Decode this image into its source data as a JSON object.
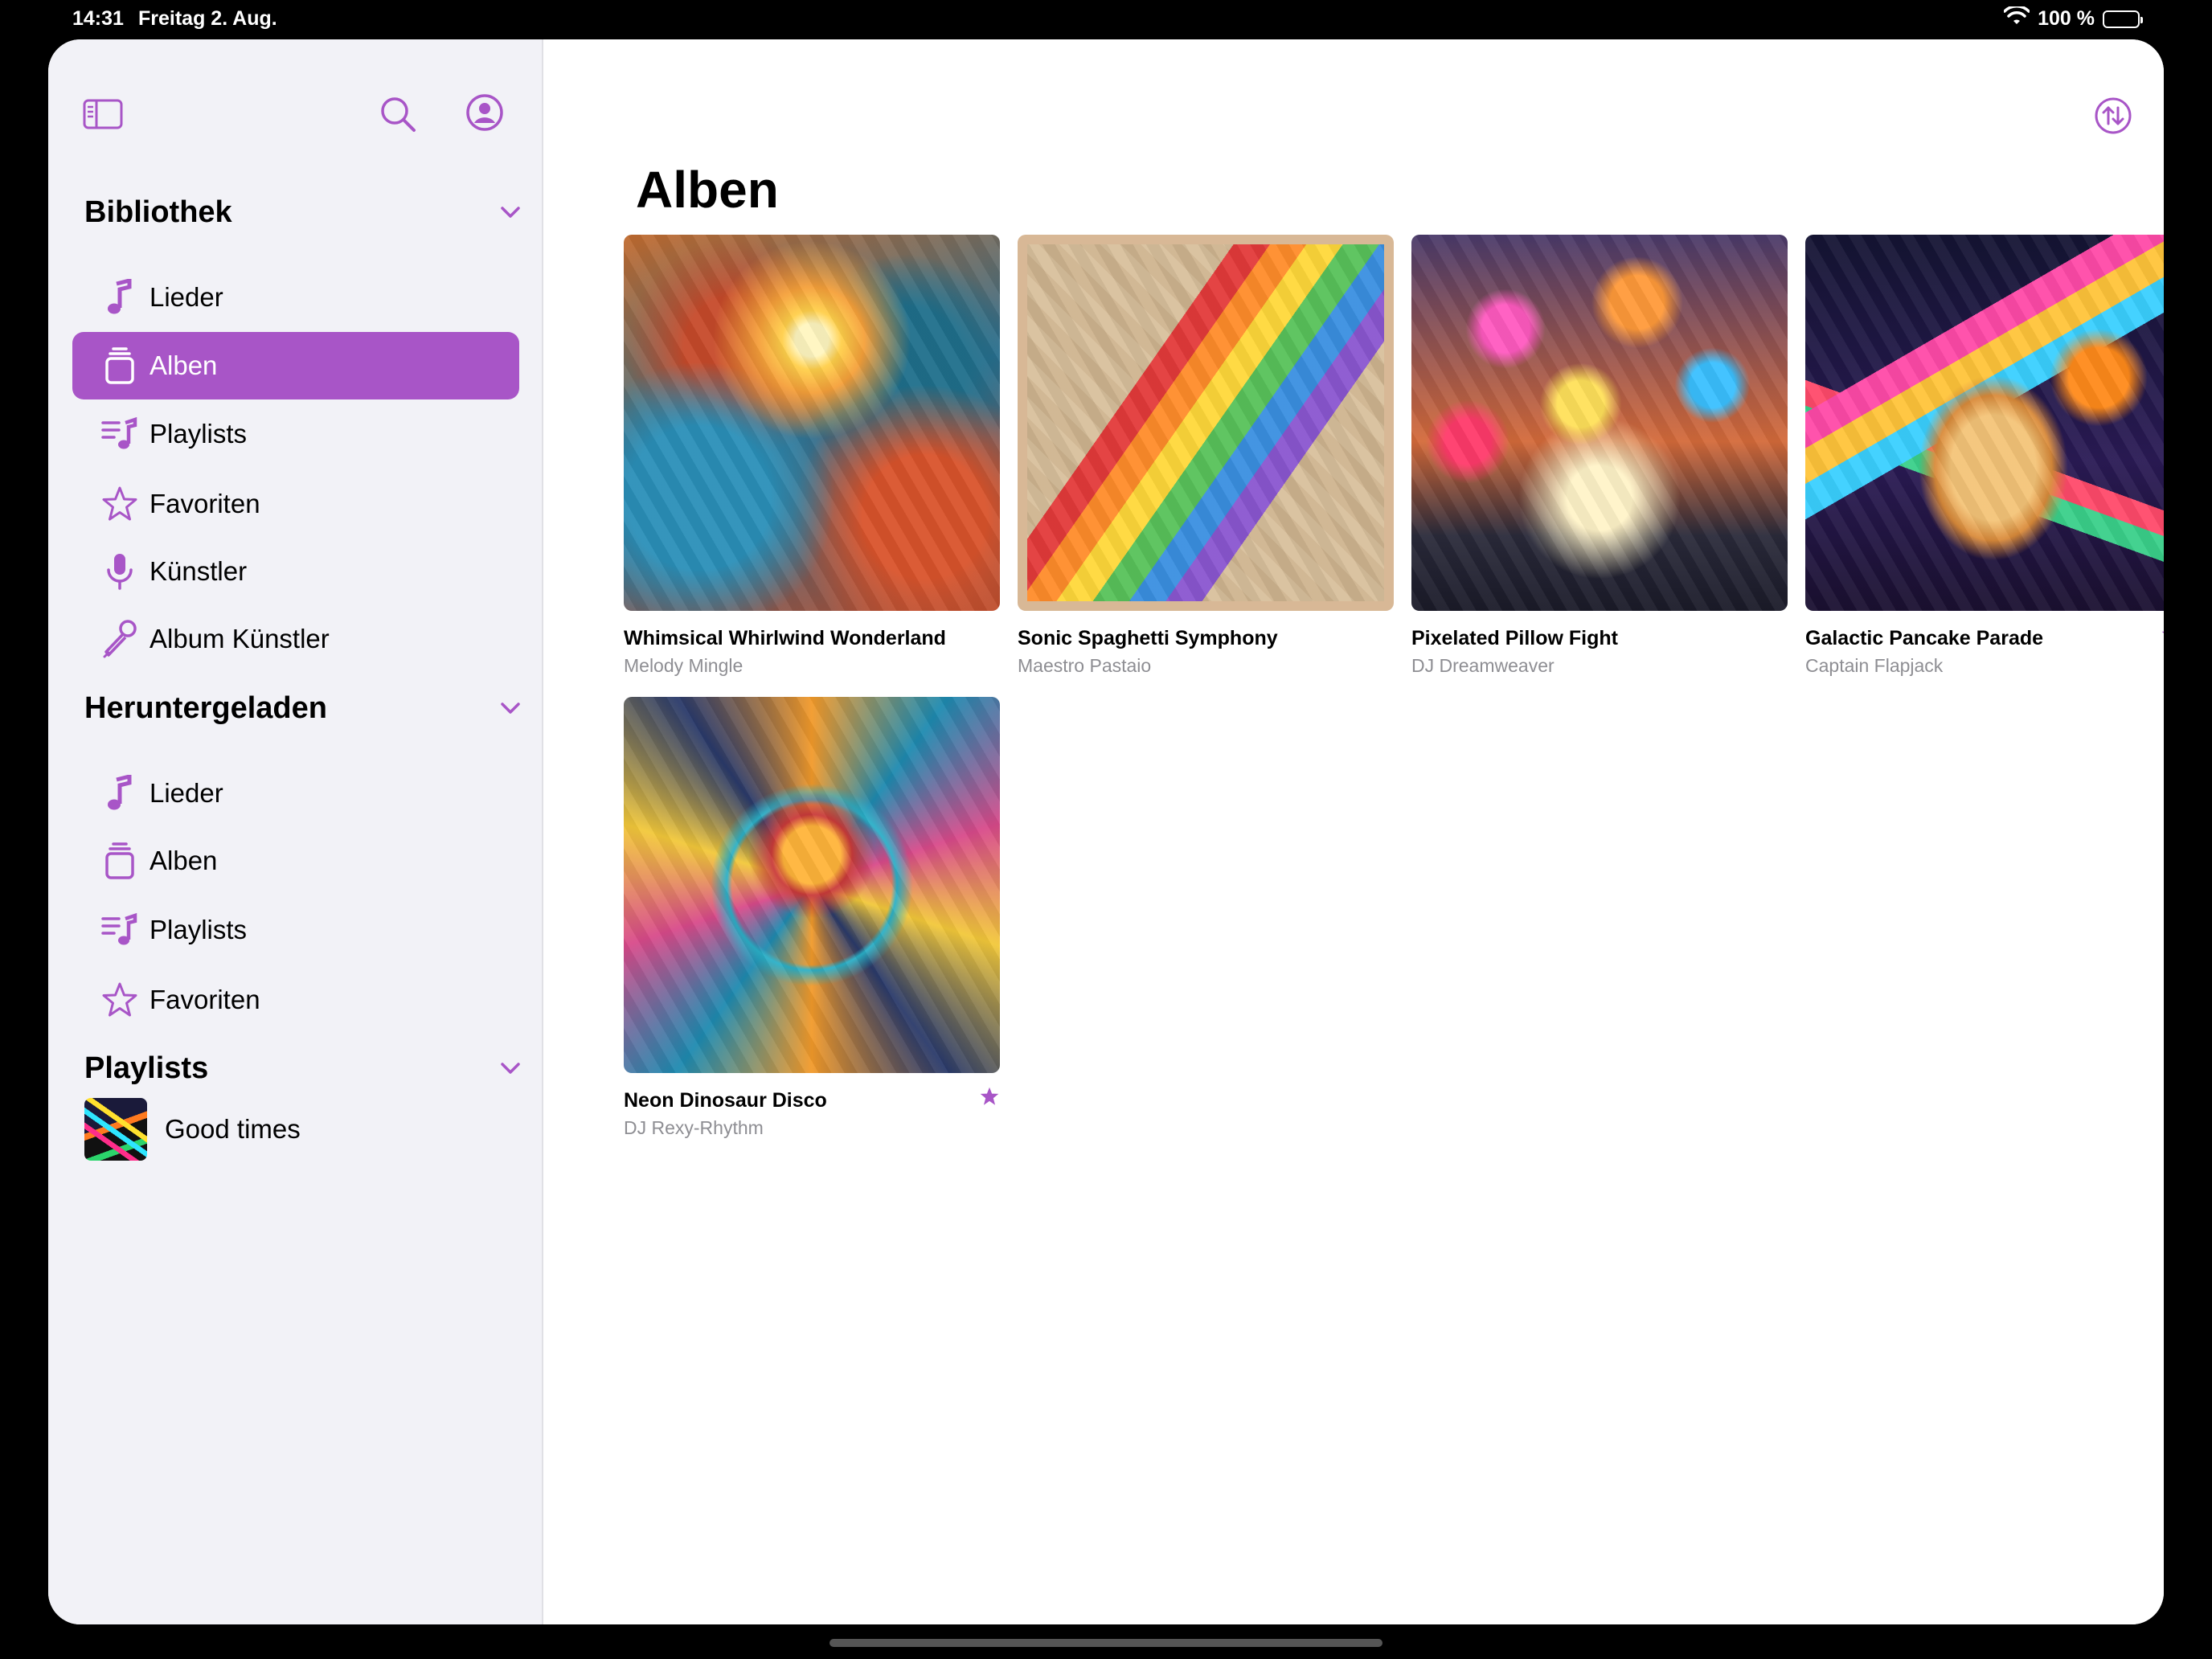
{
  "status": {
    "time": "14:31",
    "date": "Freitag 2. Aug.",
    "battery": "100 %",
    "battery_level": 1.0
  },
  "accent_color": "#a855c7",
  "toolbar": {
    "icons": [
      "sidebar-toggle-icon",
      "search-icon",
      "account-icon",
      "sort-icon"
    ]
  },
  "sidebar": {
    "library": {
      "title": "Bibliothek",
      "items": [
        {
          "label": "Lieder",
          "icon": "music-note-icon"
        },
        {
          "label": "Alben",
          "icon": "album-stack-icon",
          "selected": true
        },
        {
          "label": "Playlists",
          "icon": "playlist-icon"
        },
        {
          "label": "Favoriten",
          "icon": "star-icon"
        },
        {
          "label": "Künstler",
          "icon": "microphone-icon"
        },
        {
          "label": "Album Künstler",
          "icon": "mic-stand-icon"
        }
      ]
    },
    "downloaded": {
      "title": "Heruntergeladen",
      "items": [
        {
          "label": "Lieder",
          "icon": "music-note-icon"
        },
        {
          "label": "Alben",
          "icon": "album-stack-icon"
        },
        {
          "label": "Playlists",
          "icon": "playlist-icon"
        },
        {
          "label": "Favoriten",
          "icon": "star-icon"
        }
      ]
    },
    "playlists": {
      "title": "Playlists",
      "items": [
        {
          "name": "Good times"
        }
      ]
    }
  },
  "main": {
    "title": "Alben",
    "albums": [
      {
        "title": "Whimsical Whirlwind Wonderland",
        "artist": "Melody Mingle",
        "favorite": false
      },
      {
        "title": "Sonic Spaghetti Symphony",
        "artist": "Maestro Pastaio",
        "favorite": false
      },
      {
        "title": "Pixelated Pillow Fight",
        "artist": "DJ Dreamweaver",
        "favorite": false
      },
      {
        "title": "Galactic Pancake Parade",
        "artist": "Captain Flapjack",
        "favorite": true
      },
      {
        "title": "Neon Dinosaur Disco",
        "artist": "DJ Rexy-Rhythm",
        "favorite": true
      }
    ]
  }
}
